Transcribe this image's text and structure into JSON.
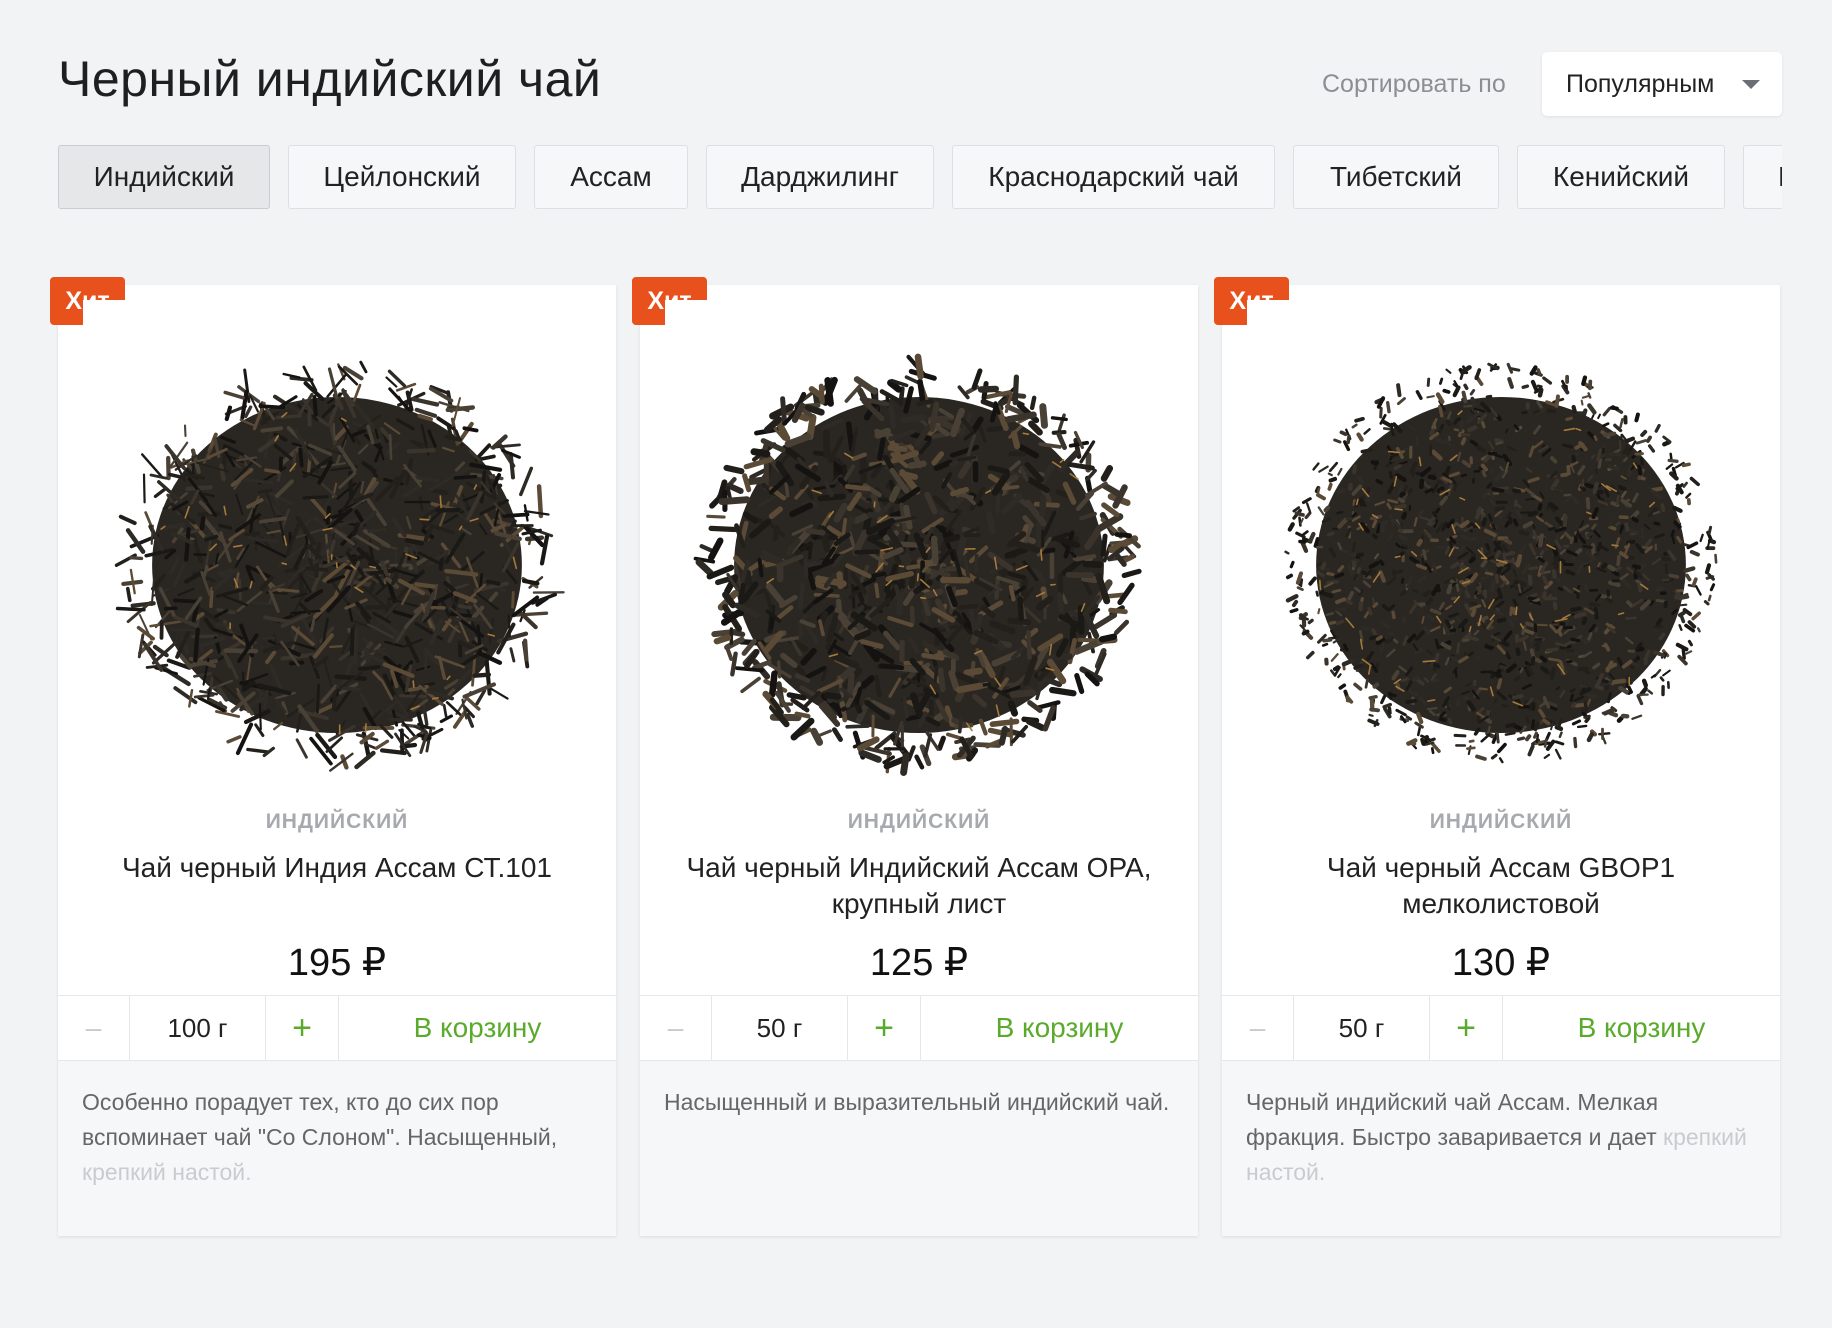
{
  "page": {
    "title": "Черный индийский чай",
    "sort_label": "Сортировать по",
    "sort_value": "Популярным"
  },
  "tabs": [
    {
      "label": "Индийский",
      "active": true
    },
    {
      "label": "Цейлонский",
      "active": false
    },
    {
      "label": "Ассам",
      "active": false
    },
    {
      "label": "Дарджилинг",
      "active": false
    },
    {
      "label": "Краснодарский чай",
      "active": false
    },
    {
      "label": "Тибетский",
      "active": false
    },
    {
      "label": "Кенийский",
      "active": false
    },
    {
      "label": "К",
      "active": false
    }
  ],
  "products": [
    {
      "badge": "Хит",
      "category": "индийский",
      "name": "Чай черный Индия Ассам СТ.101",
      "price": "195 ₽",
      "minus": "–",
      "qty": "100 г",
      "plus": "+",
      "cart": "В корзину",
      "desc_main": "Особенно порадует тех, кто до сих пор вспоминает чай \"Со Слоном\". Насыщенный,",
      "desc_fade": "крепкий настой."
    },
    {
      "badge": "Хит",
      "category": "индийский",
      "name": "Чай черный Индийский Ассам OPA, крупный лист",
      "price": "125 ₽",
      "minus": "–",
      "qty": "50 г",
      "plus": "+",
      "cart": "В корзину",
      "desc_main": "Насыщенный и выразительный индийский чай.",
      "desc_fade": ""
    },
    {
      "badge": "Хит",
      "category": "индийский",
      "name": "Чай черный Ассам GBOP1 мелколистовой",
      "price": "130 ₽",
      "minus": "–",
      "qty": "50 г",
      "plus": "+",
      "cart": "В корзину",
      "desc_main": "Черный индийский чай Ассам. Мелкая фракция. Быстро заваривается и дает",
      "desc_fade": "крепкий настой."
    }
  ],
  "colors": {
    "badge": "#e8511b",
    "accent_green": "#5aaa2c",
    "background": "#f2f3f5"
  }
}
